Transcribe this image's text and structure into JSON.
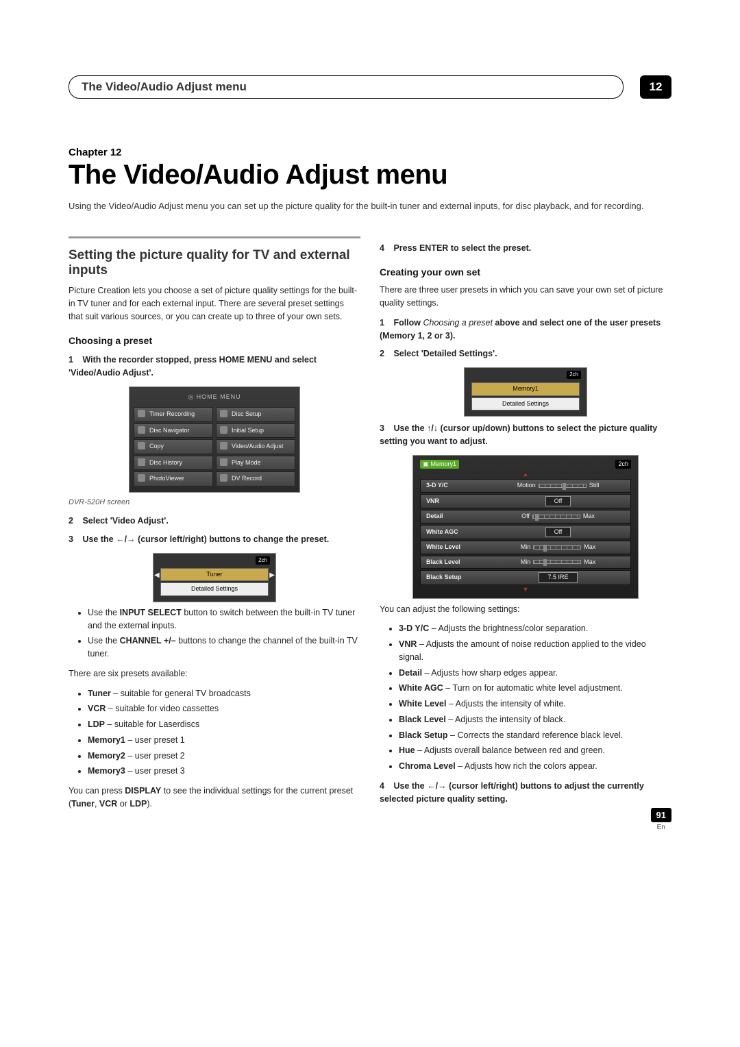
{
  "header": {
    "title": "The Video/Audio Adjust menu",
    "chapter_badge": "12"
  },
  "chapter_label": "Chapter 12",
  "main_title": "The Video/Audio Adjust menu",
  "intro": "Using the Video/Audio Adjust menu you can set up the picture quality for the built-in tuner and external inputs, for disc playback, and for recording.",
  "left": {
    "section_title": "Setting the picture quality for TV and external inputs",
    "section_body": "Picture Creation lets you choose a set of picture quality settings for the built-in TV tuner and for each external input. There are several preset settings that suit various sources, or you can create up to three of your own sets.",
    "sub1": "Choosing a preset",
    "step1_num": "1",
    "step1": "With the recorder stopped, press HOME MENU and select 'Video/Audio Adjust'.",
    "home_menu": {
      "logo": "HOME MENU",
      "col1": [
        "Timer Recording",
        "Disc Navigator",
        "Copy",
        "Disc History",
        "PhotoViewer"
      ],
      "col2": [
        "Disc Setup",
        "Initial Setup",
        "Video/Audio Adjust",
        "Play Mode",
        "DV Record"
      ]
    },
    "caption": "DVR-520H screen",
    "step2_num": "2",
    "step2": "Select 'Video Adjust'.",
    "step3_num": "3",
    "step3a": "Use the ",
    "step3_arrows": "←/→",
    "step3b": " (cursor left/right) buttons to change the preset.",
    "osd_small": {
      "badge": "2ch",
      "row1": "Tuner",
      "row2": "Detailed Settings"
    },
    "tip1a": "Use the ",
    "tip1b": "INPUT SELECT",
    "tip1c": " button to switch between the built-in TV tuner and the external inputs.",
    "tip2a": "Use the ",
    "tip2b": "CHANNEL +/–",
    "tip2c": " buttons to change the channel of the built-in TV tuner.",
    "presets_intro": "There are six presets available:",
    "presets": [
      {
        "b": "Tuner",
        "t": " – suitable for general TV broadcasts"
      },
      {
        "b": "VCR",
        "t": " – suitable for video cassettes"
      },
      {
        "b": "LDP",
        "t": " – suitable for Laserdiscs"
      },
      {
        "b": "Memory1",
        "t": " – user preset 1"
      },
      {
        "b": "Memory2",
        "t": " – user preset 2"
      },
      {
        "b": "Memory3",
        "t": " – user preset 3"
      }
    ],
    "display_a": "You can press ",
    "display_b": "DISPLAY",
    "display_c": " to see the individual settings for the current preset (",
    "display_d": "Tuner",
    "display_e": ", ",
    "display_f": "VCR",
    "display_g": " or ",
    "display_h": "LDP",
    "display_i": ")."
  },
  "right": {
    "step4_num": "4",
    "step4": "Press ENTER to select the preset.",
    "sub1": "Creating your own set",
    "body1": "There are three user presets in which you can save your own set of picture quality settings.",
    "r1_num": "1",
    "r1a": "Follow ",
    "r1_italic": "Choosing a preset",
    "r1b": " above and select one of the user presets (Memory 1, 2 or 3).",
    "r2_num": "2",
    "r2": "Select 'Detailed Settings'.",
    "osd_mem": {
      "badge": "2ch",
      "row1": "Memory1",
      "row2": "Detailed Settings"
    },
    "r3_num": "3",
    "r3a": "Use the ",
    "r3_arrows": "↑/↓",
    "r3b": " (cursor up/down) buttons to select the picture quality setting you want to adjust.",
    "detail_hdr_left": "Memory1",
    "detail_hdr_right": "2ch",
    "detail_rows": [
      {
        "n": "3-D Y/C",
        "l": "Motion",
        "r": "Still",
        "kind": "slider",
        "knob": 50
      },
      {
        "n": "VNR",
        "v": "Off",
        "kind": "box"
      },
      {
        "n": "Detail",
        "l": "Off",
        "r": "Max",
        "kind": "slider",
        "knob": 5
      },
      {
        "n": "White AGC",
        "v": "Off",
        "kind": "box"
      },
      {
        "n": "White Level",
        "l": "Min",
        "r": "Max",
        "kind": "slider",
        "knob": 20
      },
      {
        "n": "Black Level",
        "l": "Min",
        "r": "Max",
        "kind": "slider",
        "knob": 20
      },
      {
        "n": "Black Setup",
        "v": "7.5 IRE",
        "kind": "box"
      }
    ],
    "adjust_intro": "You can adjust the following settings:",
    "settings": [
      {
        "b": "3-D Y/C",
        "t": " – Adjusts the brightness/color separation."
      },
      {
        "b": "VNR",
        "t": " – Adjusts the amount of noise reduction applied to the video signal."
      },
      {
        "b": "Detail",
        "t": " – Adjusts how sharp edges appear."
      },
      {
        "b": "White AGC",
        "t": " – Turn on for automatic white level adjustment."
      },
      {
        "b": "White Level",
        "t": " – Adjusts the intensity of white."
      },
      {
        "b": "Black Level",
        "t": " – Adjusts the intensity of black."
      },
      {
        "b": "Black Setup",
        "t": " – Corrects the standard reference black level."
      },
      {
        "b": "Hue",
        "t": " – Adjusts overall balance between red and green."
      },
      {
        "b": "Chroma Level",
        "t": " – Adjusts how rich the colors appear."
      }
    ],
    "r4_num": "4",
    "r4a": "Use the ",
    "r4_arrows": "←/→",
    "r4b": " (cursor left/right) buttons to adjust the currently selected picture quality setting."
  },
  "footer": {
    "page": "91",
    "lang": "En"
  }
}
